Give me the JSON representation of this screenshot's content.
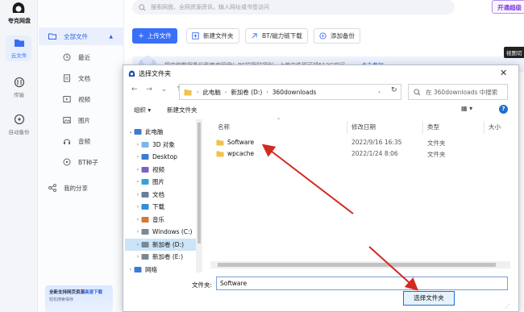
{
  "app": {
    "name": "夸克网盘",
    "vip_label": "开通超级"
  },
  "rail": {
    "items": [
      {
        "label": "云文件",
        "icon": "folder-icon"
      },
      {
        "label": "传输",
        "icon": "transfer-icon"
      },
      {
        "label": "自动备份",
        "icon": "backup-icon"
      }
    ]
  },
  "sidebar": {
    "root_label": "全部文件",
    "items": [
      {
        "label": "最近",
        "icon": "clock-icon"
      },
      {
        "label": "文档",
        "icon": "document-icon"
      },
      {
        "label": "视频",
        "icon": "video-icon"
      },
      {
        "label": "图片",
        "icon": "image-icon"
      },
      {
        "label": "音频",
        "icon": "audio-icon"
      },
      {
        "label": "BT种子",
        "icon": "bt-icon"
      }
    ],
    "share_label": "我的分享",
    "promo_line1_a": "全新支持网页资源",
    "promo_line1_b": "高速下载",
    "promo_line2": "轻松搜索保存"
  },
  "search": {
    "placeholder": "搜索网盘、全网资源资讯，输入网址或书签访问"
  },
  "toolbar": {
    "upload_label": "上传文件",
    "new_folder_label": "新建文件夹",
    "bt_label": "BT/磁力链下载",
    "backup_label": "添加备份"
  },
  "banner": {
    "text": "把电脑数据备份到夸克网盘！PC端限时福利，上传文件即可领512G空间",
    "link": "点击参加"
  },
  "tooltip": {
    "text": "视图切"
  },
  "dialog": {
    "title": "选择文件夹",
    "close": "✕",
    "breadcrumb": [
      "此电脑",
      "新加卷 (D:)",
      "360downloads"
    ],
    "search_placeholder": "在 360downloads 中搜索",
    "organize_label": "组织 ▾",
    "new_folder_label": "新建文件夹",
    "view_label": "▦ ▾",
    "help_label": "?",
    "tree": [
      {
        "label": "此电脑",
        "icon": "computer-icon",
        "expander": "⌄",
        "level": 0,
        "selected": false
      },
      {
        "label": "3D 对象",
        "icon": "cube-icon",
        "expander": "›",
        "level": 1,
        "selected": false
      },
      {
        "label": "Desktop",
        "icon": "desktop-icon",
        "expander": "›",
        "level": 1,
        "selected": false
      },
      {
        "label": "视频",
        "icon": "video-folder-icon",
        "expander": "›",
        "level": 1,
        "selected": false
      },
      {
        "label": "图片",
        "icon": "pictures-folder-icon",
        "expander": "›",
        "level": 1,
        "selected": false
      },
      {
        "label": "文档",
        "icon": "documents-folder-icon",
        "expander": "›",
        "level": 1,
        "selected": false
      },
      {
        "label": "下载",
        "icon": "download-folder-icon",
        "expander": "›",
        "level": 1,
        "selected": false
      },
      {
        "label": "音乐",
        "icon": "music-folder-icon",
        "expander": "›",
        "level": 1,
        "selected": false
      },
      {
        "label": "Windows (C:)",
        "icon": "drive-icon",
        "expander": "›",
        "level": 1,
        "selected": false
      },
      {
        "label": "新加卷 (D:)",
        "icon": "drive-icon",
        "expander": "›",
        "level": 1,
        "selected": true
      },
      {
        "label": "新加卷 (E:)",
        "icon": "drive-icon",
        "expander": "›",
        "level": 1,
        "selected": false
      },
      {
        "label": "网络",
        "icon": "network-icon",
        "expander": "›",
        "level": 0,
        "selected": false
      }
    ],
    "columns": [
      "名称",
      "修改日期",
      "类型",
      "大小"
    ],
    "files": [
      {
        "name": "Software",
        "modified": "2022/9/16 16:35",
        "type": "文件夹"
      },
      {
        "name": "wpcache",
        "modified": "2022/1/24 8:06",
        "type": "文件夹"
      }
    ],
    "filename_label": "文件夹:",
    "filename_value": "Software",
    "select_button": "选择文件夹"
  },
  "colors": {
    "accent": "#3a6ff7",
    "arrow": "#d32a1f",
    "selection": "#cce4f7",
    "folder": "#f2c14e"
  }
}
